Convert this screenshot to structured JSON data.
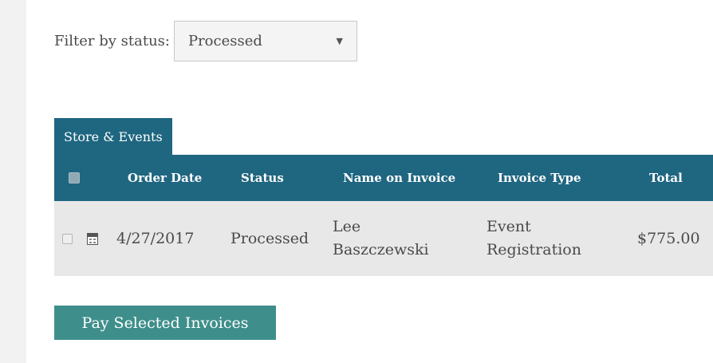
{
  "filter": {
    "label": "Filter by status:",
    "selected": "Processed",
    "caret": "▼"
  },
  "tab": {
    "label": "Store & Events"
  },
  "table": {
    "headers": {
      "order_date": "Order Date",
      "status": "Status",
      "name": "Name on Invoice",
      "type": "Invoice Type",
      "total": "Total"
    },
    "rows": [
      {
        "order_date": "4/27/2017",
        "status": "Processed",
        "name_line1": "Lee",
        "name_line2": "Baszczewski",
        "type_line1": "Event",
        "type_line2": "Registration",
        "total": "$775.00"
      }
    ]
  },
  "actions": {
    "pay_label": "Pay Selected Invoices"
  },
  "colors": {
    "header_bg": "#1f6680",
    "row_bg": "#e8e8e8",
    "button_bg": "#3e8f8b"
  }
}
